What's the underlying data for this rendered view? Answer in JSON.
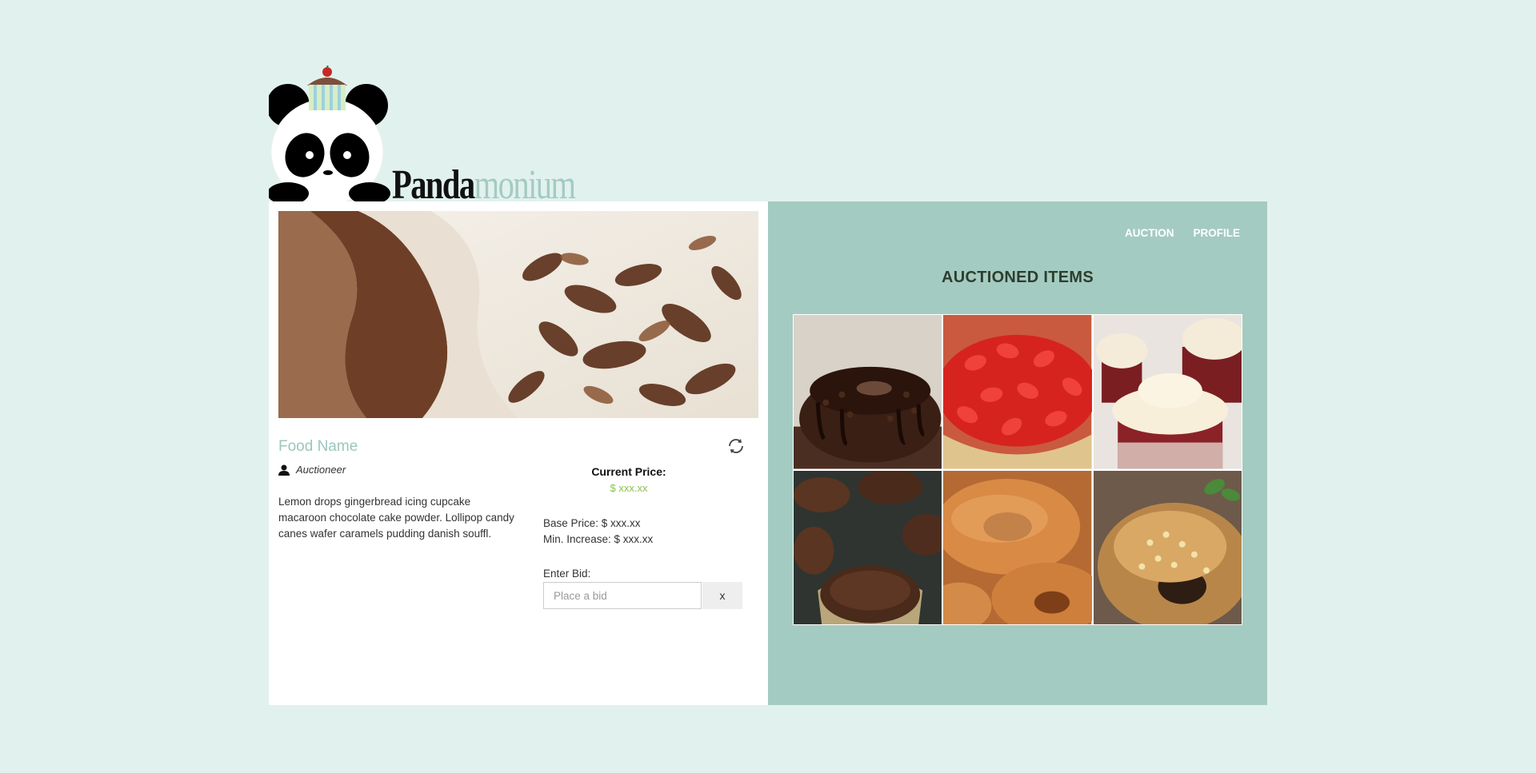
{
  "brand": {
    "name_part1": "Panda",
    "name_part2": "monium"
  },
  "nav": {
    "auction": "AUCTION",
    "profile": "PROFILE"
  },
  "item": {
    "name": "Food Name",
    "auctioneer": "Auctioneer",
    "description": "Lemon drops gingerbread icing cupcake macaroon chocolate cake powder. Lollipop candy canes wafer caramels pudding danish souffl.",
    "current_price_label": "Current Price:",
    "current_price": "$ xxx.xx",
    "base_price": "Base Price: $ xxx.xx",
    "min_increase": "Min. Increase: $ xxx.xx",
    "bid_label": "Enter Bid:",
    "bid_placeholder": "Place a bid",
    "bid_button": "x"
  },
  "auctioned": {
    "title": "AUCTIONED ITEMS",
    "items": [
      {
        "icon": "chocolate-bundt-cake"
      },
      {
        "icon": "strawberry-cheesecake"
      },
      {
        "icon": "red-velvet-cupcakes"
      },
      {
        "icon": "chocolate-muffins"
      },
      {
        "icon": "glazed-donuts"
      },
      {
        "icon": "sprinkled-donut"
      }
    ]
  },
  "colors": {
    "accent": "#a4cbc1",
    "page_bg": "#e1f1ee",
    "price": "#8bc34a",
    "food_name": "#99c7bd"
  }
}
